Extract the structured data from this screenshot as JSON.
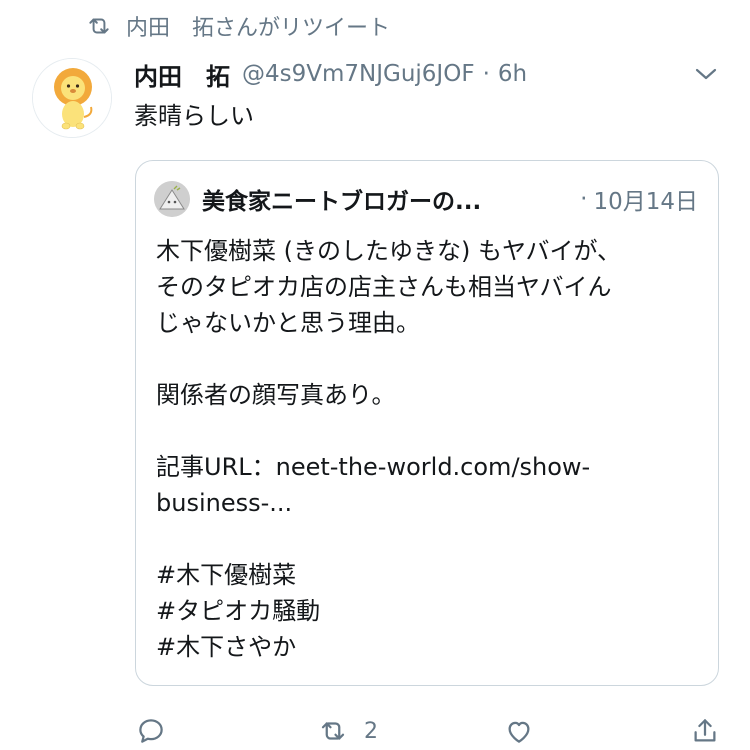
{
  "retweet_context": {
    "icon": "retweet-icon",
    "text": "内田　拓さんがリツイート"
  },
  "tweet": {
    "display_name": "内田　拓",
    "handle": "@4s9Vm7NJGuj6JOF",
    "separator": "·",
    "time": "6h",
    "text": "素晴らしい",
    "avatar_icon": "lion-avatar-icon",
    "menu_icon": "chevron-down-icon"
  },
  "quoted": {
    "display_name": "美食家ニートブロガーの...",
    "separator": "·",
    "date": "10月14日",
    "avatar_icon": "blogger-avatar-icon",
    "lines": [
      "木下優樹菜 (きのしたゆきな) もヤバイが、",
      "そのタピオカ店の店主さんも相当ヤバイん",
      "じゃないかと思う理由。",
      "",
      "関係者の顔写真あり。",
      "",
      "記事URL：neet-the-world.com/show-",
      "business-...",
      "",
      "#木下優樹菜",
      "#タピオカ騒動",
      "#木下さやか"
    ]
  },
  "actions": {
    "reply_icon": "reply-icon",
    "retweet_icon": "retweet-icon",
    "retweet_count": "2",
    "like_icon": "heart-icon",
    "share_icon": "share-icon"
  },
  "colors": {
    "text_primary": "#14171a",
    "text_secondary": "#657786",
    "border": "#ccd6dd",
    "background": "#ffffff"
  }
}
